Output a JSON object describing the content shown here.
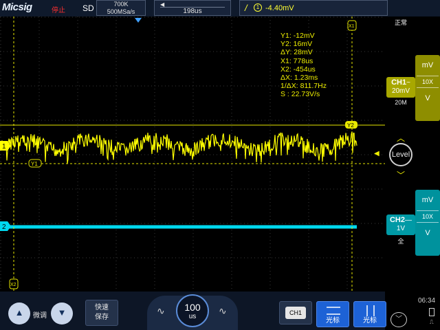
{
  "header": {
    "brand": "Micsig",
    "run_state": "停止",
    "acq_mode": "SD",
    "memory_depth": "700K",
    "sample_rate": "500MSa/s",
    "timebase_position": "198us",
    "trigger_source": "1",
    "trigger_level": "-4.40mV",
    "language": "正常"
  },
  "readout": {
    "y1": "Y1:  -12mV",
    "y2": "Y2:  16mV",
    "dy": "ΔY:  28mV",
    "x1": "X1:  778us",
    "x2": "X2:  -454us",
    "dx": "ΔX:  1.23ms",
    "inv_dx": "1/ΔX:  811.7Hz",
    "slope": "S :  22.73V/s"
  },
  "markers": {
    "ch1": "1",
    "ch2": "2",
    "y1": "Y1",
    "y2": "Y2",
    "x1": "X1",
    "x2": "X2"
  },
  "channels": {
    "ch1": {
      "label": "CH1",
      "coupling": "~",
      "scale": "20mV",
      "bw": "20M",
      "color": "#ffff00"
    },
    "ch2": {
      "label": "CH2",
      "coupling": "—",
      "scale": "1V",
      "bw": "全",
      "color": "#00d8ee"
    }
  },
  "vertical_panel": {
    "ch1": {
      "unit": "mV",
      "probe": "10X",
      "down": "V"
    },
    "ch2": {
      "unit": "mV",
      "probe": "10X",
      "down": "V"
    }
  },
  "trigger_panel": {
    "level_label": "Level"
  },
  "bottom": {
    "fine_label": "微调",
    "save_label_1": "快速",
    "save_label_2": "保存",
    "timebase_value": "100",
    "timebase_unit": "us",
    "ch1_button": "CH1",
    "cursor_h_label": "光标",
    "cursor_v_label": "光标"
  },
  "status": {
    "clock": "06:34"
  }
}
